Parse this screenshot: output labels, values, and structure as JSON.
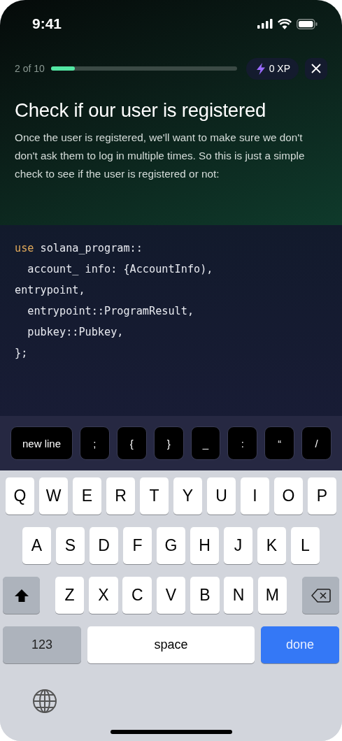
{
  "status_bar": {
    "time": "9:41"
  },
  "progress": {
    "label": "2 of 10",
    "level": 0.13
  },
  "xp_badge": {
    "text": "0 XP"
  },
  "lesson": {
    "title": "Check if our user is registered",
    "body": "Once the user is registered, we'll want to make sure we don't don't ask them to log in multiple times. So this is just a simple check to see if the user is registered or not:"
  },
  "code_lines": [
    [
      {
        "kind": "keyword",
        "text": "use"
      },
      {
        "kind": "plain",
        "text": " solana_program::"
      }
    ],
    [
      {
        "kind": "plain",
        "text": "  account_ info: {AccountInfo),"
      }
    ],
    [
      {
        "kind": "plain",
        "text": "entrypoint,"
      }
    ],
    [
      {
        "kind": "plain",
        "text": "  entrypoint::ProgramResult,"
      }
    ],
    [
      {
        "kind": "plain",
        "text": "  pubkey::Pubkey,"
      }
    ],
    [
      {
        "kind": "plain",
        "text": "};"
      }
    ]
  ],
  "snippet_keys": [
    "new line",
    ";",
    "{",
    "}",
    "_",
    ":",
    "“",
    "/"
  ],
  "keyboard_rows": [
    [
      {
        "kind": "letter",
        "label": "Q"
      },
      {
        "kind": "letter",
        "label": "W"
      },
      {
        "kind": "letter",
        "label": "E"
      },
      {
        "kind": "letter",
        "label": "R"
      },
      {
        "kind": "letter",
        "label": "T"
      },
      {
        "kind": "letter",
        "label": "Y"
      },
      {
        "kind": "letter",
        "label": "U"
      },
      {
        "kind": "letter",
        "label": "I"
      },
      {
        "kind": "letter",
        "label": "O"
      },
      {
        "kind": "letter",
        "label": "P"
      }
    ],
    [
      {
        "kind": "letter",
        "label": "A"
      },
      {
        "kind": "letter",
        "label": "S"
      },
      {
        "kind": "letter",
        "label": "D"
      },
      {
        "kind": "letter",
        "label": "F"
      },
      {
        "kind": "letter",
        "label": "G"
      },
      {
        "kind": "letter",
        "label": "H"
      },
      {
        "kind": "letter",
        "label": "J"
      },
      {
        "kind": "letter",
        "label": "K"
      },
      {
        "kind": "letter",
        "label": "L"
      }
    ],
    [
      {
        "kind": "shift"
      },
      {
        "kind": "letter",
        "label": "Z"
      },
      {
        "kind": "letter",
        "label": "X"
      },
      {
        "kind": "letter",
        "label": "C"
      },
      {
        "kind": "letter",
        "label": "V"
      },
      {
        "kind": "letter",
        "label": "B"
      },
      {
        "kind": "letter",
        "label": "N"
      },
      {
        "kind": "letter",
        "label": "M"
      },
      {
        "kind": "backspace"
      }
    ],
    [
      {
        "kind": "mode",
        "label": "123"
      },
      {
        "kind": "space",
        "label": "space"
      },
      {
        "kind": "done",
        "label": "done"
      }
    ]
  ]
}
